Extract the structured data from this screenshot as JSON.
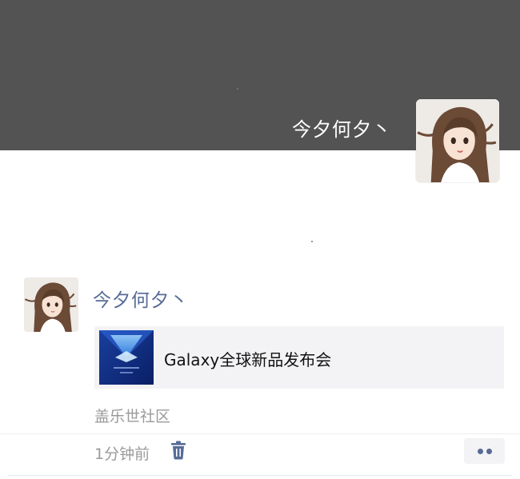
{
  "cover": {
    "name": "今夕何夕丶",
    "background_color": "#535353",
    "avatar_icon": "anime-girl-avatar"
  },
  "post": {
    "author": "今夕何夕丶",
    "author_color": "#576b95",
    "avatar_icon": "anime-girl-avatar",
    "link_card": {
      "title": "Galaxy全球新品发布会",
      "thumbnail_icon": "samsung-galaxy-blue-thumbnail"
    },
    "source": "盖乐世社区",
    "time": "1分钟前",
    "delete_icon": "trash-icon",
    "more_icon": "more-dots-icon"
  }
}
